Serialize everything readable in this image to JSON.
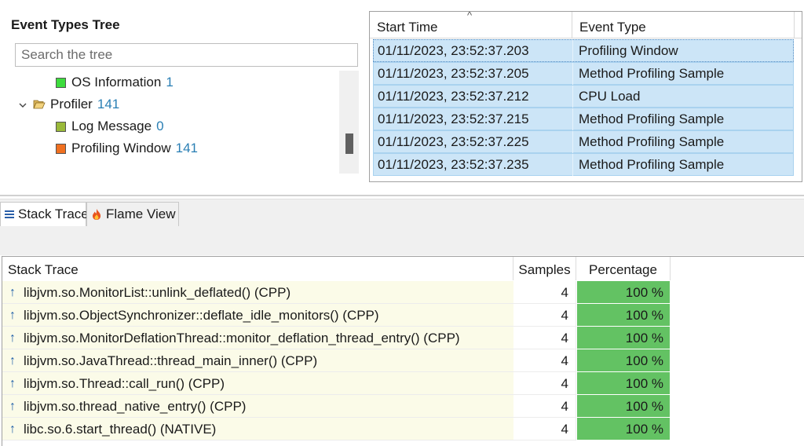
{
  "tree": {
    "title": "Event Types Tree",
    "search_placeholder": "Search the tree",
    "items": [
      {
        "label": "OS Information",
        "count": "1",
        "color": "#3ddc3d"
      },
      {
        "label": "Profiler",
        "count": "141",
        "icon": "folder-open-icon",
        "expanded": true
      },
      {
        "label": "Log Message",
        "count": "0",
        "color": "#9ab93a"
      },
      {
        "label": "Profiling Window",
        "count": "141",
        "color": "#f07020"
      }
    ]
  },
  "events": {
    "columns": [
      "Start Time",
      "Event Type"
    ],
    "rows": [
      {
        "start": "01/11/2023, 23:52:37.203",
        "type": "Profiling Window"
      },
      {
        "start": "01/11/2023, 23:52:37.205",
        "type": "Method Profiling Sample"
      },
      {
        "start": "01/11/2023, 23:52:37.212",
        "type": "CPU Load"
      },
      {
        "start": "01/11/2023, 23:52:37.215",
        "type": "Method Profiling Sample"
      },
      {
        "start": "01/11/2023, 23:52:37.225",
        "type": "Method Profiling Sample"
      },
      {
        "start": "01/11/2023, 23:52:37.235",
        "type": "Method Profiling Sample"
      }
    ]
  },
  "tabs": [
    {
      "label": "Stack Trace",
      "icon": "list-icon",
      "active": true
    },
    {
      "label": "Flame View",
      "icon": "flame-icon",
      "active": false
    }
  ],
  "stack_trace": {
    "columns": [
      "Stack Trace",
      "Samples",
      "Percentage"
    ],
    "accent_color": "#63c263",
    "rows": [
      {
        "frame": "libjvm.so.MonitorList::unlink_deflated() (CPP)",
        "samples": "4",
        "percentage": "100 %"
      },
      {
        "frame": "libjvm.so.ObjectSynchronizer::deflate_idle_monitors() (CPP)",
        "samples": "4",
        "percentage": "100 %"
      },
      {
        "frame": "libjvm.so.MonitorDeflationThread::monitor_deflation_thread_entry() (CPP)",
        "samples": "4",
        "percentage": "100 %"
      },
      {
        "frame": "libjvm.so.JavaThread::thread_main_inner() (CPP)",
        "samples": "4",
        "percentage": "100 %"
      },
      {
        "frame": "libjvm.so.Thread::call_run() (CPP)",
        "samples": "4",
        "percentage": "100 %"
      },
      {
        "frame": "libjvm.so.thread_native_entry() (CPP)",
        "samples": "4",
        "percentage": "100 %"
      },
      {
        "frame": "libc.so.6.start_thread() (NATIVE)",
        "samples": "4",
        "percentage": "100 %"
      }
    ]
  }
}
